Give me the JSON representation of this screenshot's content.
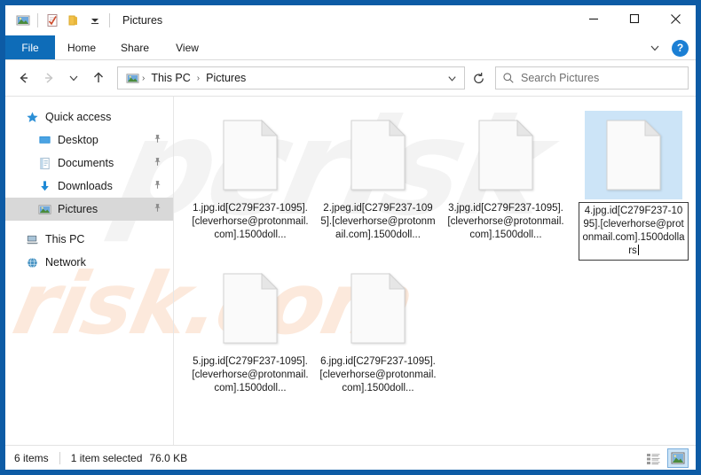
{
  "window": {
    "title": "Pictures",
    "quick_access_icons": [
      "pictures-icon",
      "properties-icon",
      "new-folder-icon",
      "customize-dropdown-icon"
    ],
    "controls": {
      "minimize": "–",
      "maximize": "□",
      "close": "✕"
    },
    "border_color": "#0d5ba5"
  },
  "ribbon": {
    "tabs": [
      {
        "label": "File",
        "active": true
      },
      {
        "label": "Home",
        "active": false
      },
      {
        "label": "Share",
        "active": false
      },
      {
        "label": "View",
        "active": false
      }
    ],
    "expand_icon": "chevron-down-icon",
    "help_label": "?",
    "file_tab_color": "#0e6cb8"
  },
  "address": {
    "back_icon": "arrow-left-icon",
    "forward_icon": "arrow-right-icon",
    "recent_icon": "chevron-down-icon",
    "up_icon": "arrow-up-icon",
    "location_icon": "pictures-icon",
    "breadcrumbs": [
      "This PC",
      "Pictures"
    ],
    "separator": "›",
    "dropdown_icon": "chevron-down-icon",
    "refresh_icon": "refresh-icon"
  },
  "search": {
    "icon": "search-icon",
    "placeholder": "Search Pictures",
    "value": ""
  },
  "sidebar": {
    "items": [
      {
        "label": "Quick access",
        "icon": "star-icon",
        "child": false,
        "pinned": false,
        "selected": false
      },
      {
        "label": "Desktop",
        "icon": "desktop-icon",
        "child": true,
        "pinned": true,
        "selected": false
      },
      {
        "label": "Documents",
        "icon": "documents-icon",
        "child": true,
        "pinned": true,
        "selected": false
      },
      {
        "label": "Downloads",
        "icon": "downloads-icon",
        "child": true,
        "pinned": true,
        "selected": false
      },
      {
        "label": "Pictures",
        "icon": "pictures-icon",
        "child": true,
        "pinned": true,
        "selected": true
      },
      {
        "label": "This PC",
        "icon": "thispc-icon",
        "child": false,
        "pinned": false,
        "selected": false
      },
      {
        "label": "Network",
        "icon": "network-icon",
        "child": false,
        "pinned": false,
        "selected": false
      }
    ]
  },
  "files": [
    {
      "name": "1.jpg.id[C279F237-1095].[cleverhorse@protonmail.com].1500doll...",
      "icon": "generic-file-icon",
      "selected": false
    },
    {
      "name": "2.jpeg.id[C279F237-1095].[cleverhorse@protonmail.com].1500doll...",
      "icon": "generic-file-icon",
      "selected": false
    },
    {
      "name": "3.jpg.id[C279F237-1095].[cleverhorse@protonmail.com].1500doll...",
      "icon": "generic-file-icon",
      "selected": false
    },
    {
      "name": "4.jpg.id[C279F237-1095].[cleverhorse@protonmail.com].1500dollars",
      "icon": "generic-file-icon",
      "selected": true
    },
    {
      "name": "5.jpg.id[C279F237-1095].[cleverhorse@protonmail.com].1500doll...",
      "icon": "generic-file-icon",
      "selected": false
    },
    {
      "name": "6.jpg.id[C279F237-1095].[cleverhorse@protonmail.com].1500doll...",
      "icon": "generic-file-icon",
      "selected": false
    }
  ],
  "status": {
    "item_count": "6 items",
    "selection": "1 item selected",
    "size": "76.0 KB",
    "details_view_icon": "details-view-icon",
    "large_icons_view_icon": "large-icons-view-icon",
    "active_view": "large-icons"
  },
  "watermarks": {
    "upper": "pcrisk",
    "lower": "risk.com",
    "upper_color": "rgba(140,140,140,0.10)",
    "lower_color": "rgba(238,120,40,0.16)"
  },
  "colors": {
    "selection_highlight": "#cce4f7",
    "sidebar_selected": "#d8d8d8",
    "accent": "#0e6cb8"
  }
}
